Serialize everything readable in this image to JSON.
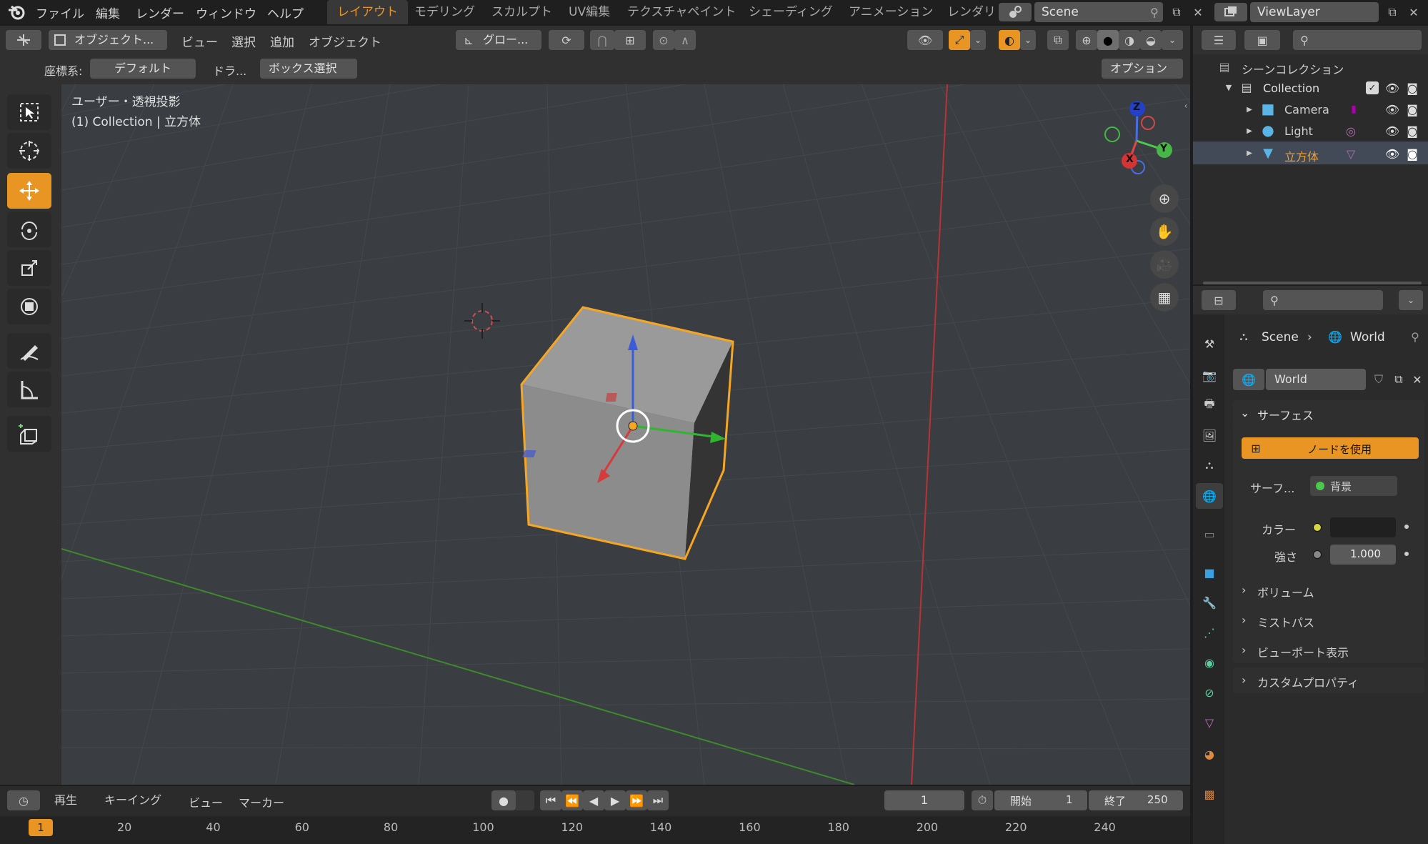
{
  "menu": {
    "items": [
      "ファイル",
      "編集",
      "レンダー",
      "ウィンドウ",
      "ヘルプ"
    ]
  },
  "workspaces": [
    "レイアウト",
    "モデリング",
    "スカルプト",
    "UV編集",
    "テクスチャペイント",
    "シェーディング",
    "アニメーション",
    "レンダリ"
  ],
  "scene_name": "Scene",
  "viewlayer_name": "ViewLayer",
  "header": {
    "mode": "オブジェクト...",
    "view": "ビュー",
    "select": "選択",
    "add": "追加",
    "object": "オブジェクト",
    "orientation": "グロー...",
    "coord_label": "座標系:",
    "coord_value": "デフォルト",
    "drag_label": "ドラ...",
    "drag_value": "ボックス選択",
    "options": "オプション"
  },
  "viewport": {
    "info_line1": "ユーザー・透視投影",
    "info_line2": "(1) Collection | 立方体"
  },
  "gizmo": {
    "x": "X",
    "y": "Y",
    "z": "Z"
  },
  "outliner": {
    "root": "シーンコレクション",
    "collection": "Collection",
    "items": [
      "Camera",
      "Light",
      "立方体"
    ]
  },
  "properties": {
    "breadcrumb_scene": "Scene",
    "breadcrumb_world": "World",
    "world_name": "World",
    "surface_header": "サーフェス",
    "use_nodes": "ノードを使用",
    "surface_label": "サーフ...",
    "surface_value": "背景",
    "color_label": "カラー",
    "strength_label": "強さ",
    "strength_value": "1.000",
    "sections": [
      "ボリューム",
      "ミストパス",
      "ビューポート表示",
      "カスタムプロパティ"
    ]
  },
  "timeline": {
    "play": "再生",
    "keying": "キーイング",
    "view": "ビュー",
    "marker": "マーカー",
    "current_frame": "1",
    "start_label": "開始",
    "start_value": "1",
    "end_label": "終了",
    "end_value": "250",
    "ruler": [
      "20",
      "40",
      "60",
      "80",
      "100",
      "120",
      "140",
      "160",
      "180",
      "200",
      "220",
      "240"
    ],
    "frame_marker": "1"
  },
  "colors": {
    "accent": "#e89523",
    "selected_outline": "#f5a623"
  }
}
